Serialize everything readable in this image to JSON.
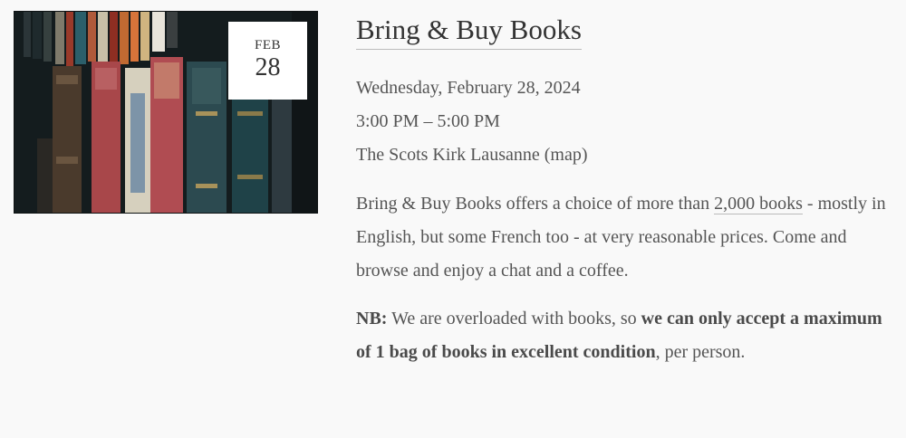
{
  "image": {
    "alt": "books-on-shelf"
  },
  "date_badge": {
    "month": "FEB",
    "day": "28"
  },
  "event": {
    "title": "Bring & Buy Books",
    "date": "Wednesday, February 28, 2024",
    "time": "3:00 PM – 5:00 PM",
    "location": "The Scots Kirk Lausanne",
    "map_open": "(",
    "map_label": "map",
    "map_close": ")"
  },
  "description": {
    "before_link": "Bring & Buy Books offers a choice of more than ",
    "link": "2,000 books",
    "after_link": " - mostly in English, but some French too - at very reasonable prices. Come and browse and enjoy a chat and a coffee."
  },
  "notice": {
    "prefix": "NB:",
    "text1": "  We are overloaded with books, so  ",
    "bold1": "we can only accept a maximum of 1  bag of books in excellent condition",
    "text2": ", per person."
  },
  "colors": {
    "background": "#f9f9f9",
    "text": "#555555",
    "title": "#333333"
  }
}
